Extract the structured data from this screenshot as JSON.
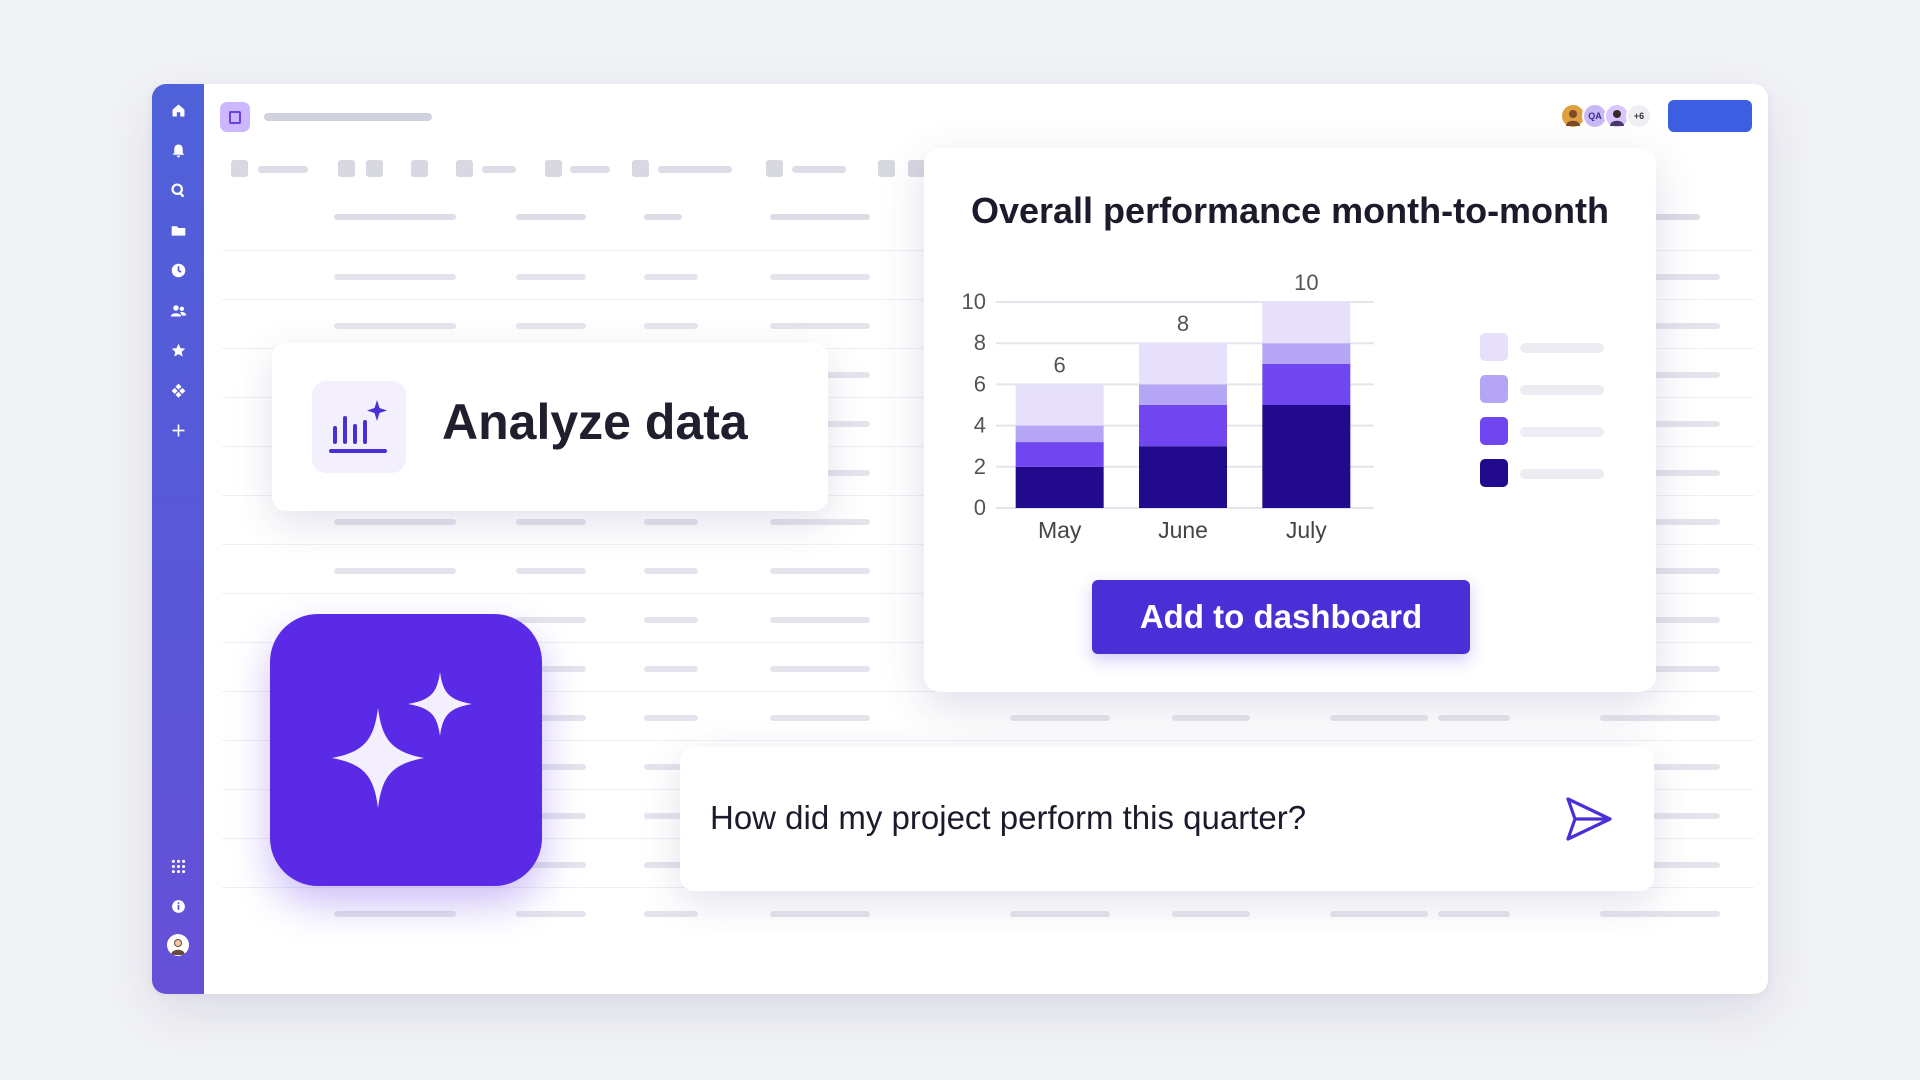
{
  "analyze_card": {
    "title": "Analyze data"
  },
  "chart_card": {
    "title": "Overall performance month-to-month",
    "button_label": "Add to dashboard"
  },
  "prompt": {
    "text": "How did my project perform this quarter?"
  },
  "header": {
    "collaborators": [
      {
        "initials": "",
        "color": "#e0a040"
      },
      {
        "initials": "QA",
        "color": "#c9b8f5"
      },
      {
        "initials": "",
        "color": "#d7c6ff"
      }
    ],
    "more_count": "+6"
  },
  "sidebar": {
    "top_icons": [
      "home-icon",
      "bell-icon",
      "search-icon",
      "folder-icon",
      "clock-icon",
      "people-icon",
      "star-icon",
      "apps-icon",
      "plus-icon"
    ],
    "bottom_icons": [
      "grid-icon",
      "help-icon",
      "profile-avatar-icon"
    ]
  },
  "chart_data": {
    "type": "bar",
    "stacked": true,
    "categories": [
      "May",
      "June",
      "July"
    ],
    "totals": [
      6,
      8,
      10
    ],
    "ylim": [
      0,
      10
    ],
    "yticks": [
      0,
      2,
      4,
      6,
      8,
      10
    ],
    "grid": true,
    "legend_position": "right",
    "series": [
      {
        "color": "#220a8c",
        "values": [
          2,
          3,
          5
        ]
      },
      {
        "color": "#6f46f0",
        "values": [
          1.2,
          2,
          2
        ]
      },
      {
        "color": "#b4a6f4",
        "values": [
          0.8,
          1,
          1
        ]
      },
      {
        "color": "#e6e0fb",
        "values": [
          2,
          2,
          2
        ]
      }
    ]
  }
}
